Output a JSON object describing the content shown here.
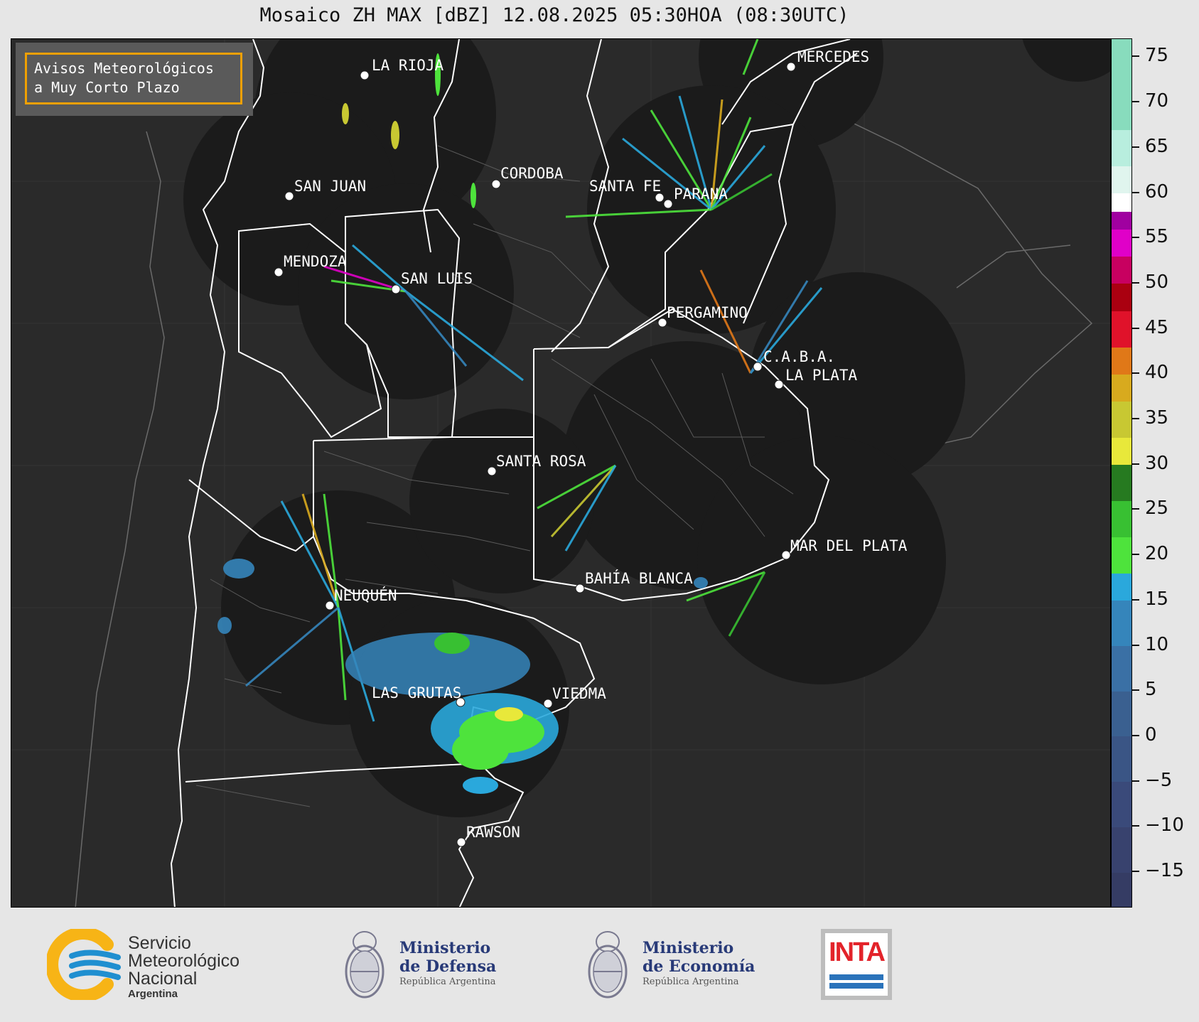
{
  "title": "Mosaico ZH MAX [dBZ] 12.08.2025 05:30HOA (08:30UTC)",
  "notice": {
    "line1": "Avisos Meteorológicos",
    "line2": "a Muy Corto Plazo"
  },
  "cities": [
    {
      "name": "LA RIOJA"
    },
    {
      "name": "MERCEDES"
    },
    {
      "name": "SAN JUAN"
    },
    {
      "name": "CORDOBA"
    },
    {
      "name": "SANTA FE"
    },
    {
      "name": "PARANA"
    },
    {
      "name": "MENDOZA"
    },
    {
      "name": "SAN LUIS"
    },
    {
      "name": "PERGAMINO"
    },
    {
      "name": "C.A.B.A."
    },
    {
      "name": "LA PLATA"
    },
    {
      "name": "SANTA ROSA"
    },
    {
      "name": "MAR DEL PLATA"
    },
    {
      "name": "BAHÍA BLANCA"
    },
    {
      "name": "NEUQUÉN"
    },
    {
      "name": "LAS GRUTAS"
    },
    {
      "name": "VIEDMA"
    },
    {
      "name": "RAWSON"
    }
  ],
  "colorbar": {
    "unit": "dBZ",
    "min": -19,
    "max": 77,
    "ticks": [
      "75",
      "70",
      "65",
      "60",
      "55",
      "50",
      "45",
      "40",
      "35",
      "30",
      "25",
      "20",
      "15",
      "10",
      "5",
      "0",
      "−5",
      "−10",
      "−15"
    ],
    "tick_values": [
      75,
      70,
      65,
      60,
      55,
      50,
      45,
      40,
      35,
      30,
      25,
      20,
      15,
      10,
      5,
      0,
      -5,
      -10,
      -15
    ],
    "colors": [
      {
        "from": -19,
        "to": -15,
        "color": "#353c64"
      },
      {
        "from": -15,
        "to": -10,
        "color": "#38426e"
      },
      {
        "from": -10,
        "to": -5,
        "color": "#3a4a7a"
      },
      {
        "from": -5,
        "to": 0,
        "color": "#3a5585"
      },
      {
        "from": 0,
        "to": 5,
        "color": "#3a6090"
      },
      {
        "from": 5,
        "to": 10,
        "color": "#3a70a5"
      },
      {
        "from": 10,
        "to": 15,
        "color": "#3585bb"
      },
      {
        "from": 15,
        "to": 18,
        "color": "#2aa8dc"
      },
      {
        "from": 18,
        "to": 22,
        "color": "#4ee33c"
      },
      {
        "from": 22,
        "to": 26,
        "color": "#38c032"
      },
      {
        "from": 26,
        "to": 30,
        "color": "#267a20"
      },
      {
        "from": 30,
        "to": 33,
        "color": "#e8e83a"
      },
      {
        "from": 33,
        "to": 37,
        "color": "#c8c832"
      },
      {
        "from": 37,
        "to": 40,
        "color": "#d8aa1e"
      },
      {
        "from": 40,
        "to": 43,
        "color": "#e07818"
      },
      {
        "from": 43,
        "to": 47,
        "color": "#e0122a"
      },
      {
        "from": 47,
        "to": 50,
        "color": "#aa0010"
      },
      {
        "from": 50,
        "to": 53,
        "color": "#c80060"
      },
      {
        "from": 53,
        "to": 56,
        "color": "#e000c8"
      },
      {
        "from": 56,
        "to": 58,
        "color": "#a000a0"
      },
      {
        "from": 58,
        "to": 60,
        "color": "#ffffff"
      },
      {
        "from": 60,
        "to": 63,
        "color": "#e0f5ee"
      },
      {
        "from": 63,
        "to": 67,
        "color": "#b8eede"
      },
      {
        "from": 67,
        "to": 77,
        "color": "#88dcbd"
      }
    ]
  },
  "logos": {
    "smn": {
      "line1": "Servicio",
      "line2": "Meteorológico",
      "line3": "Nacional",
      "line4": "Argentina"
    },
    "defensa": {
      "line1": "Ministerio",
      "line2": "de Defensa",
      "line3": "República Argentina"
    },
    "economia": {
      "line1": "Ministerio",
      "line2": "de Economía",
      "line3": "República Argentina"
    },
    "inta": {
      "text": "INTA"
    }
  },
  "colors": {
    "map_bg": "#2a2a2a",
    "radar_disk": "#1b1b1b",
    "border_accent": "#f0a000",
    "smn_yellow": "#f7b416",
    "smn_blue": "#1f8fd0",
    "inta_red": "#e3232a",
    "inta_blue": "#2a73bb",
    "ministerio_blue": "#283a78"
  }
}
